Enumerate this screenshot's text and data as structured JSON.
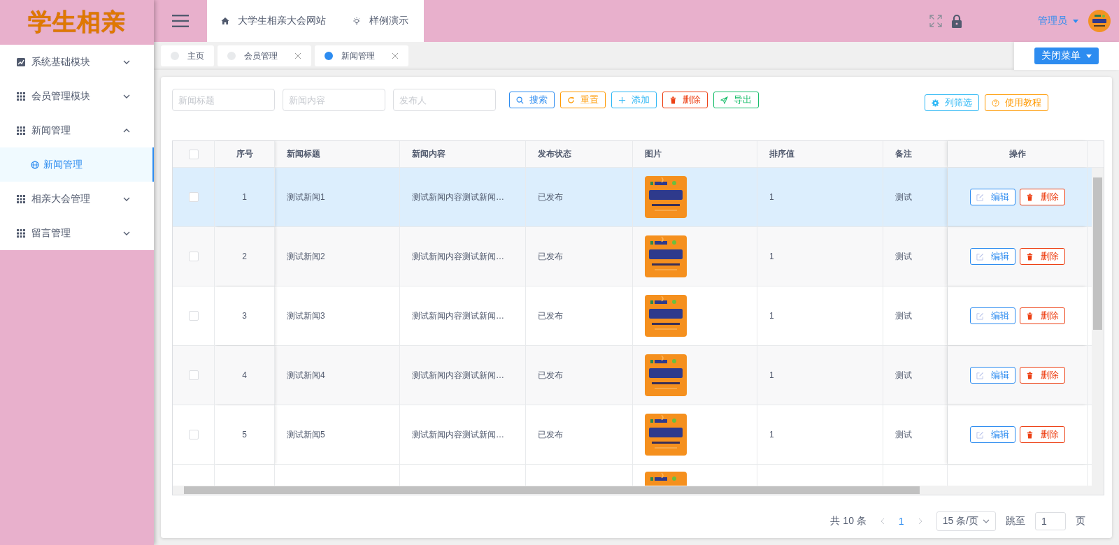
{
  "logo": "学生相亲",
  "sidebar": {
    "items": [
      {
        "label": "系统基础模块",
        "kind": "chart",
        "expanded": false
      },
      {
        "label": "会员管理模块",
        "kind": "grid",
        "expanded": false
      },
      {
        "label": "新闻管理",
        "kind": "grid",
        "expanded": true,
        "children": [
          {
            "label": "新闻管理",
            "selected": true
          }
        ]
      },
      {
        "label": "相亲大会管理",
        "kind": "grid",
        "expanded": false
      },
      {
        "label": "留言管理",
        "kind": "grid",
        "expanded": false
      }
    ]
  },
  "header": {
    "links": [
      {
        "label": "大学生相亲大会网站",
        "kind": "home"
      },
      {
        "label": "样例演示",
        "kind": "bulb"
      }
    ],
    "user": "管理员"
  },
  "tabs": [
    {
      "label": "主页",
      "selected": false,
      "closable": false
    },
    {
      "label": "会员管理",
      "selected": false,
      "closable": true
    },
    {
      "label": "新闻管理",
      "selected": true,
      "closable": true
    }
  ],
  "close_menu": "关闭菜单",
  "filters": [
    {
      "placeholder": "新闻标题"
    },
    {
      "placeholder": "新闻内容"
    },
    {
      "placeholder": "发布人"
    }
  ],
  "actions": [
    {
      "label": "搜索",
      "kind": "search"
    },
    {
      "label": "重置",
      "kind": "reset"
    },
    {
      "label": "添加",
      "kind": "add"
    },
    {
      "label": "删除",
      "kind": "delete"
    },
    {
      "label": "导出",
      "kind": "export"
    }
  ],
  "right_actions": [
    {
      "label": "列筛选",
      "kind": "columns"
    },
    {
      "label": "使用教程",
      "kind": "help"
    }
  ],
  "table": {
    "select_all_checked": false,
    "columns": [
      "序号",
      "新闻标题",
      "新闻内容",
      "发布状态",
      "图片",
      "排序值",
      "备注",
      "操作"
    ],
    "rows": [
      {
        "index": "1",
        "title": "测试新闻1",
        "content": "测试新闻内容测试新闻…",
        "status": "已发布",
        "sort": "1",
        "remark": "测试",
        "hovered": true,
        "checked": false,
        "actions": [
          "编辑",
          "删除"
        ]
      },
      {
        "index": "2",
        "title": "测试新闻2",
        "content": "测试新闻内容测试新闻…",
        "status": "已发布",
        "sort": "1",
        "remark": "测试",
        "hovered": false,
        "checked": false,
        "actions": [
          "编辑",
          "删除"
        ]
      },
      {
        "index": "3",
        "title": "测试新闻3",
        "content": "测试新闻内容测试新闻…",
        "status": "已发布",
        "sort": "1",
        "remark": "测试",
        "hovered": false,
        "checked": false,
        "actions": [
          "编辑",
          "删除"
        ]
      },
      {
        "index": "4",
        "title": "测试新闻4",
        "content": "测试新闻内容测试新闻…",
        "status": "已发布",
        "sort": "1",
        "remark": "测试",
        "hovered": false,
        "checked": false,
        "actions": [
          "编辑",
          "删除"
        ]
      },
      {
        "index": "5",
        "title": "测试新闻5",
        "content": "测试新闻内容测试新闻…",
        "status": "已发布",
        "sort": "1",
        "remark": "测试",
        "hovered": false,
        "checked": false,
        "actions": [
          "编辑",
          "删除"
        ]
      }
    ]
  },
  "pagination": {
    "total": "共 10 条",
    "page": "1",
    "page_size": "15 条/页",
    "jump_label": "跳至",
    "jump_value": "1",
    "page_suffix": "页"
  }
}
